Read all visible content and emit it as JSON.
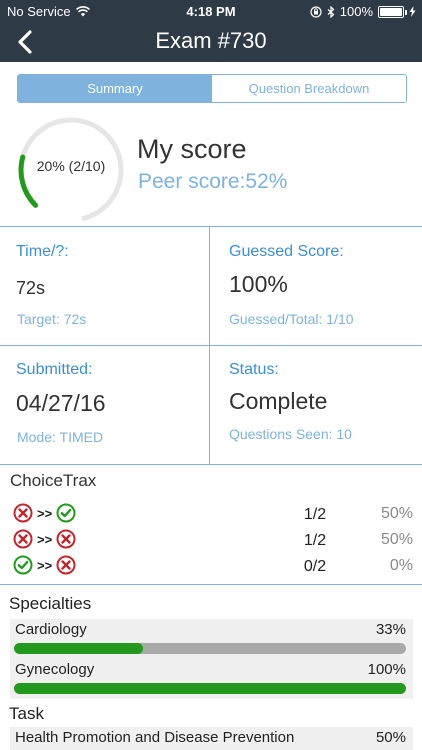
{
  "status_bar": {
    "carrier": "No Service",
    "time": "4:18 PM",
    "battery": "100%"
  },
  "nav": {
    "title": "Exam #730",
    "back_icon": "chevron-left-icon"
  },
  "tabs": [
    {
      "label": "Summary",
      "active": true
    },
    {
      "label": "Question Breakdown",
      "active": false
    }
  ],
  "score": {
    "gauge_label": "20% (2/10)",
    "gauge_fraction": 0.2,
    "my_score_label": "My score",
    "peer_score_label": "Peer score:",
    "peer_score_value": "52%"
  },
  "stats": {
    "time_title": "Time/?:",
    "time_value": "72s",
    "time_target": "Target:  72s",
    "guessed_title": "Guessed Score:",
    "guessed_value": "100%",
    "guessed_total": "Guessed/Total: 1/10",
    "submitted_title": "Submitted:",
    "submitted_value": "04/27/16",
    "mode": "Mode: TIMED",
    "status_title": "Status:",
    "status_value": "Complete",
    "questions_seen": "Questions Seen:  10"
  },
  "choicetrax": {
    "title": "ChoiceTrax",
    "arrow": ">>",
    "rows": [
      {
        "from": "wrong",
        "to": "correct",
        "fraction": "1/2",
        "percent": "50%"
      },
      {
        "from": "wrong",
        "to": "wrong",
        "fraction": "1/2",
        "percent": "50%"
      },
      {
        "from": "correct",
        "to": "wrong",
        "fraction": "0/2",
        "percent": "0%"
      }
    ]
  },
  "specialties": {
    "title": "Specialties",
    "items": [
      {
        "name": "Cardiology",
        "percent": "33%",
        "fraction": 0.33
      },
      {
        "name": "Gynecology",
        "percent": "100%",
        "fraction": 1.0
      }
    ]
  },
  "task": {
    "title": "Task",
    "items": [
      {
        "name": "Health Promotion and Disease Prevention",
        "percent": "50%",
        "fraction": 0.5
      }
    ]
  },
  "colors": {
    "header": "#2f3a47",
    "accent": "#7fb3de",
    "title_blue": "#3d8fd1",
    "bar_green": "#239a1e",
    "bar_gray": "#a9a9a9",
    "wrong_red": "#c0272d",
    "correct_green": "#239a1e"
  }
}
